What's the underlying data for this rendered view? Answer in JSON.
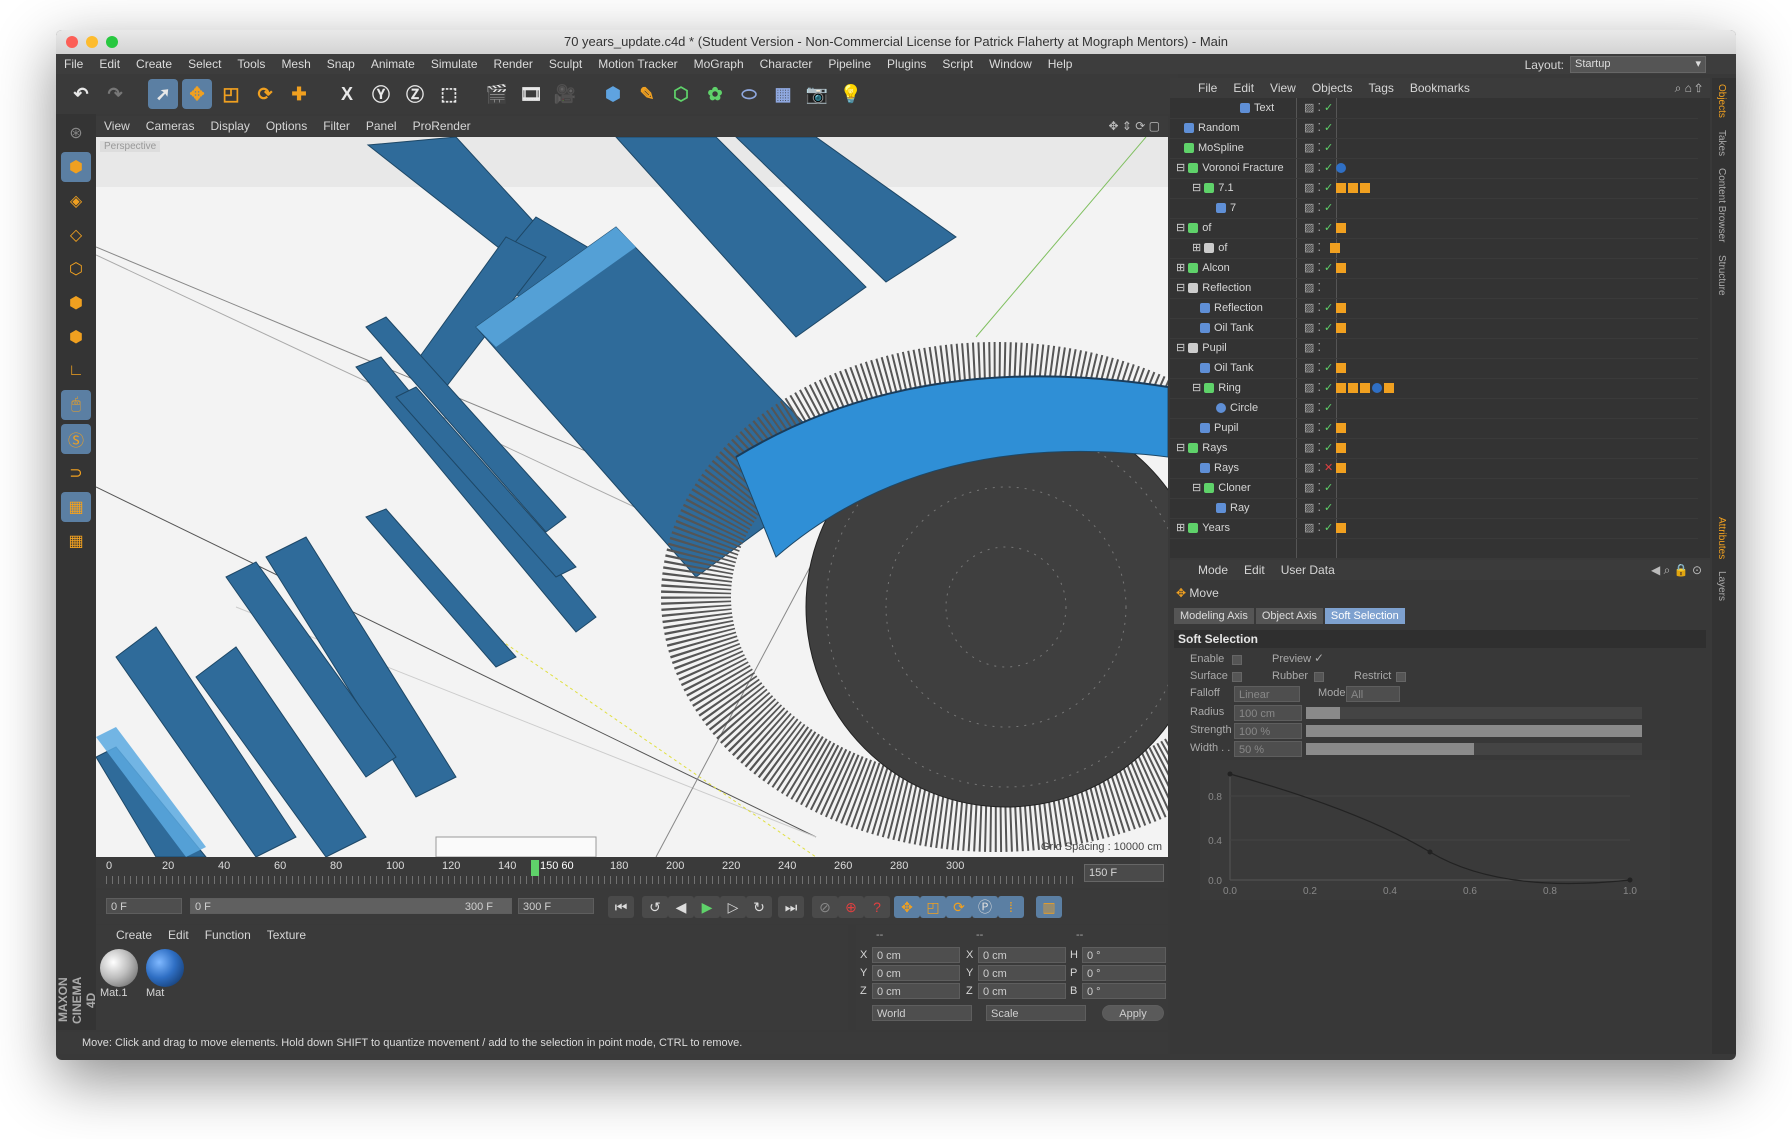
{
  "window": {
    "title": "70 years_update.c4d * (Student Version - Non-Commercial License for Patrick Flaherty at Mograph Mentors) - Main"
  },
  "menubar": {
    "items": [
      "File",
      "Edit",
      "Create",
      "Select",
      "Tools",
      "Mesh",
      "Snap",
      "Animate",
      "Simulate",
      "Render",
      "Sculpt",
      "Motion Tracker",
      "MoGraph",
      "Character",
      "Pipeline",
      "Plugins",
      "Script",
      "Window",
      "Help"
    ]
  },
  "layout": {
    "label": "Layout:",
    "value": "Startup"
  },
  "viewport": {
    "menu": [
      "View",
      "Cameras",
      "Display",
      "Options",
      "Filter",
      "Panel",
      "ProRender"
    ],
    "camera_label": "Perspective",
    "grid_spacing": "Grid Spacing : 10000 cm"
  },
  "timeline": {
    "ticks": [
      "0",
      "20",
      "40",
      "60",
      "80",
      "100",
      "120",
      "140",
      "150",
      "160",
      "180",
      "200",
      "220",
      "240",
      "260",
      "280",
      "300"
    ],
    "current_frame_label": "150 60",
    "end_frame": "150 F"
  },
  "transport": {
    "start": "0 F",
    "range_start": "0 F",
    "range_end": "300 F",
    "end": "300 F"
  },
  "material_manager": {
    "menu": [
      "Create",
      "Edit",
      "Function",
      "Texture"
    ],
    "materials": [
      {
        "name": "Mat.1",
        "color": "#d8d8d8"
      },
      {
        "name": "Mat",
        "color": "#2f6fc4"
      }
    ]
  },
  "coordinates": {
    "headers": [
      "--",
      "--",
      "--"
    ],
    "rows": [
      {
        "a": "X",
        "av": "0 cm",
        "b": "X",
        "bv": "0 cm",
        "c": "H",
        "cv": "0 °"
      },
      {
        "a": "Y",
        "av": "0 cm",
        "b": "Y",
        "bv": "0 cm",
        "c": "P",
        "cv": "0 °"
      },
      {
        "a": "Z",
        "av": "0 cm",
        "b": "Z",
        "bv": "0 cm",
        "c": "B",
        "cv": "0 °"
      }
    ],
    "mode1": "World",
    "mode2": "Scale",
    "apply": "Apply"
  },
  "brand": "MAXON CINEMA 4D",
  "status": "Move: Click and drag to move elements. Hold down SHIFT to quantize movement / add to the selection in point mode, CTRL to remove.",
  "objects": {
    "menu": [
      "File",
      "Edit",
      "View",
      "Objects",
      "Tags",
      "Bookmarks"
    ],
    "items": [
      {
        "name": "Text",
        "indent": 3,
        "icon": "#5f8fd6"
      },
      {
        "name": "Random",
        "indent": 1,
        "icon": "#5f8fd6"
      },
      {
        "name": "MoSpline",
        "indent": 1,
        "icon": "#5fd26a"
      },
      {
        "name": "Voronoi Fracture",
        "indent": 1,
        "icon": "#5fd26a"
      },
      {
        "name": "7.1",
        "indent": 2,
        "icon": "#5fd26a"
      },
      {
        "name": "7",
        "indent": 3,
        "icon": "#5f8fd6"
      },
      {
        "name": "of",
        "indent": 1,
        "icon": "#5fd26a"
      },
      {
        "name": "of",
        "indent": 2,
        "icon": "#cccccc"
      },
      {
        "name": "Alcon",
        "indent": 1,
        "icon": "#5fd26a"
      },
      {
        "name": "Reflection",
        "indent": 1,
        "icon": "#cccccc"
      },
      {
        "name": "Reflection",
        "indent": 2,
        "icon": "#5f8fd6"
      },
      {
        "name": "Oil Tank",
        "indent": 2,
        "icon": "#5f8fd6"
      },
      {
        "name": "Pupil",
        "indent": 1,
        "icon": "#cccccc"
      },
      {
        "name": "Oil Tank",
        "indent": 2,
        "icon": "#5f8fd6"
      },
      {
        "name": "Ring",
        "indent": 2,
        "icon": "#5fd26a"
      },
      {
        "name": "Circle",
        "indent": 3,
        "icon": "#5f8fd6"
      },
      {
        "name": "Pupil",
        "indent": 2,
        "icon": "#5f8fd6"
      },
      {
        "name": "Rays",
        "indent": 1,
        "icon": "#5fd26a"
      },
      {
        "name": "Rays",
        "indent": 2,
        "icon": "#5f8fd6"
      },
      {
        "name": "Cloner",
        "indent": 2,
        "icon": "#5fd26a"
      },
      {
        "name": "Ray",
        "indent": 3,
        "icon": "#5f8fd6"
      },
      {
        "name": "Years",
        "indent": 1,
        "icon": "#5fd26a"
      }
    ]
  },
  "attributes": {
    "menu": [
      "Mode",
      "Edit",
      "User Data"
    ],
    "title": "Move",
    "tabs": [
      "Modeling Axis",
      "Object Axis",
      "Soft Selection"
    ],
    "section": "Soft Selection",
    "enable": "Enable",
    "preview": "Preview",
    "surface": "Surface",
    "rubber": "Rubber",
    "restrict": "Restrict",
    "falloff_label": "Falloff",
    "falloff_value": "Linear",
    "mode_label": "Mode",
    "mode_value": "All",
    "radius_label": "Radius",
    "radius_value": "100 cm",
    "strength_label": "Strength",
    "strength_value": "100 %",
    "width_label": "Width . .",
    "width_value": "50 %",
    "radius_fill": 0.1,
    "strength_fill": 1.0,
    "width_fill": 0.5,
    "graph_y": [
      "0.8",
      "0.4",
      "0.0"
    ],
    "graph_x": [
      "0.0",
      "0.2",
      "0.4",
      "0.6",
      "0.8",
      "1.0"
    ]
  },
  "side_tabs": [
    "Objects",
    "Takes",
    "Content Browser",
    "Structure",
    "Attributes",
    "Layers"
  ]
}
